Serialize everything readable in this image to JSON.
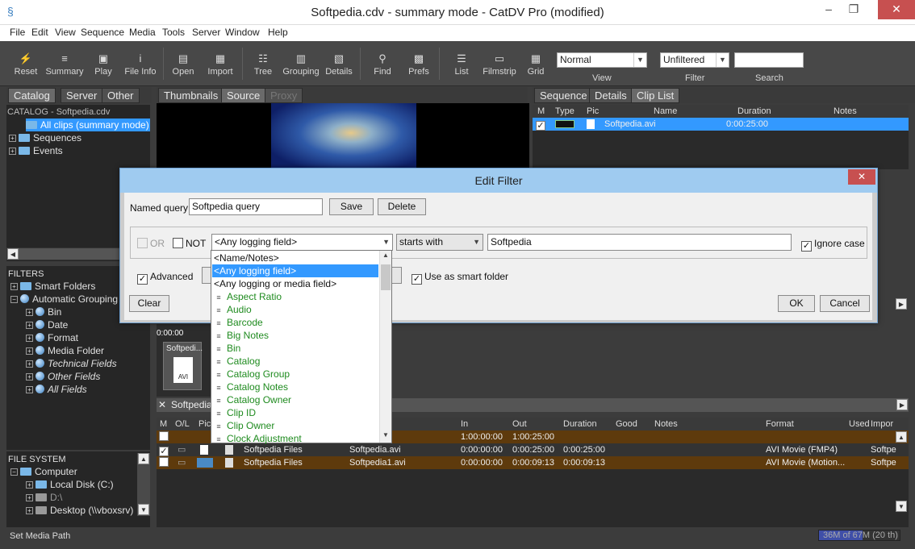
{
  "window": {
    "title": "Softpedia.cdv - summary mode - CatDV Pro (modified)"
  },
  "menu": [
    "File",
    "Edit",
    "View",
    "Sequence",
    "Media",
    "Tools",
    "Server",
    "Window",
    "Help"
  ],
  "toolbar": {
    "buttons": [
      {
        "label": "Reset",
        "icon": "bolt-icon"
      },
      {
        "label": "Summary",
        "icon": "list-icon"
      },
      {
        "label": "Play",
        "icon": "camera-icon"
      },
      {
        "label": "File Info",
        "icon": "info-icon"
      },
      {
        "label": "Open",
        "icon": "document-icon"
      },
      {
        "label": "Import",
        "icon": "film-icon"
      },
      {
        "label": "Tree",
        "icon": "tree-icon"
      },
      {
        "label": "Grouping",
        "icon": "grouping-icon"
      },
      {
        "label": "Details",
        "icon": "details-icon"
      },
      {
        "label": "Find",
        "icon": "find-icon"
      },
      {
        "label": "Prefs",
        "icon": "prefs-icon"
      },
      {
        "label": "List",
        "icon": "list-view-icon"
      },
      {
        "label": "Filmstrip",
        "icon": "filmstrip-icon"
      },
      {
        "label": "Grid",
        "icon": "grid-icon"
      }
    ],
    "view_select": "Normal",
    "view_caption": "View",
    "filter_select": "Unfiltered",
    "filter_caption": "Filter",
    "search_caption": "Search",
    "search_value": ""
  },
  "left": {
    "tabs": [
      "Catalog",
      "Server",
      "Other"
    ],
    "catalog_header": "CATALOG - Softpedia.cdv",
    "catalog_items": [
      "All clips (summary mode)",
      "Sequences",
      "Events"
    ],
    "filters_header": "FILTERS",
    "filters": [
      "Smart Folders",
      "Automatic Grouping",
      "Bin",
      "Date",
      "Format",
      "Media Folder",
      "Technical Fields",
      "Other Fields",
      "All Fields"
    ],
    "fs_header": "FILE SYSTEM",
    "fs": [
      "Computer",
      "Local Disk (C:)",
      "D:\\",
      "Desktop (\\\\vboxsrv)"
    ]
  },
  "center": {
    "tabs": [
      "Thumbnails",
      "Source",
      "Proxy"
    ],
    "timecode": "0:00:00",
    "thumb_label": "Softpedi...",
    "thumb_badge": "AVI"
  },
  "right": {
    "tabs": [
      "Sequence",
      "Details",
      "Clip List"
    ],
    "headers": [
      "M",
      "Type",
      "Pic",
      "Name",
      "Duration",
      "Notes"
    ],
    "rows": [
      {
        "name": "Softpedia.avi",
        "duration": "0:00:25:00"
      }
    ]
  },
  "bottom": {
    "tab_label": "Softpedia",
    "headers": [
      "M",
      "O/L",
      "Pic",
      "In",
      "Out",
      "Duration",
      "Good",
      "Notes",
      "Format",
      "Used",
      "Impor"
    ],
    "rows": [
      {
        "bin": "",
        "name": "",
        "in": "1:00:00:00",
        "out": "1:00:25:00",
        "duration": "",
        "format": "",
        "used": ""
      },
      {
        "bin": "Softpedia Files",
        "name": "Softpedia.avi",
        "in": "0:00:00:00",
        "out": "0:00:25:00",
        "duration": "0:00:25:00",
        "format": "AVI Movie (FMP4)",
        "used": "Softpe"
      },
      {
        "bin": "Softpedia Files",
        "name": "Softpedia1.avi",
        "in": "0:00:00:00",
        "out": "0:00:09:13",
        "duration": "0:00:09:13",
        "format": "AVI Movie (Motion...",
        "used": "Softpe"
      }
    ]
  },
  "dialog": {
    "title": "Edit Filter",
    "named_query_label": "Named query:",
    "named_query_value": "Softpedia query",
    "save": "Save",
    "delete": "Delete",
    "or_label": "OR",
    "not_label": "NOT",
    "field_select": "<Any logging field>",
    "op_select": "starts with",
    "value": "Softpedia",
    "ignore_case": "Ignore case",
    "advanced": "Advanced",
    "smart_folder": "Use as smart folder",
    "clear": "Clear",
    "ok": "OK",
    "cancel": "Cancel"
  },
  "dropdown": [
    {
      "label": "<Name/Notes>",
      "kind": "plain"
    },
    {
      "label": "<Any logging field>",
      "kind": "selected"
    },
    {
      "label": "<Any logging or media field>",
      "kind": "plain"
    },
    {
      "label": "Aspect Ratio",
      "kind": "field"
    },
    {
      "label": "Audio",
      "kind": "field"
    },
    {
      "label": "Barcode",
      "kind": "field"
    },
    {
      "label": "Big Notes",
      "kind": "field"
    },
    {
      "label": "Bin",
      "kind": "field"
    },
    {
      "label": "Catalog",
      "kind": "field"
    },
    {
      "label": "Catalog Group",
      "kind": "field"
    },
    {
      "label": "Catalog Notes",
      "kind": "field"
    },
    {
      "label": "Catalog Owner",
      "kind": "field"
    },
    {
      "label": "Clip ID",
      "kind": "field"
    },
    {
      "label": "Clip Owner",
      "kind": "field"
    },
    {
      "label": "Clock Adjustment",
      "kind": "field"
    }
  ],
  "status": {
    "left": "Set Media Path",
    "memory": "36M of 67M (20 th)"
  }
}
